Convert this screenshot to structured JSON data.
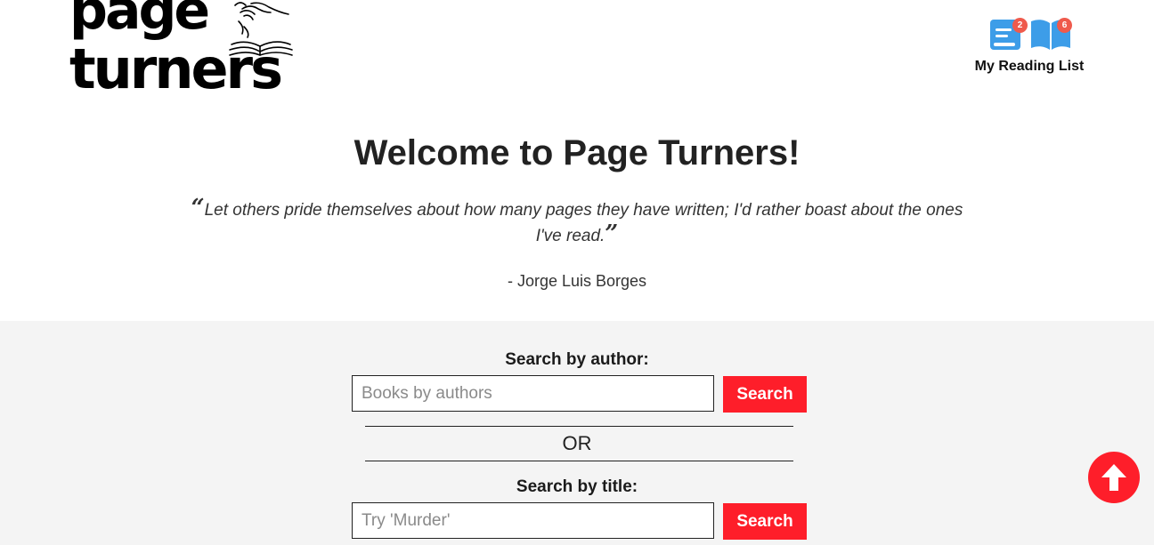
{
  "header": {
    "logo": {
      "line1": "page",
      "line2": "turners"
    },
    "reading_list": {
      "label": "My Reading List",
      "badges": [
        {
          "icon": "book-stack-icon",
          "count": "2"
        },
        {
          "icon": "open-book-icon",
          "count": "6"
        }
      ]
    }
  },
  "hero": {
    "title": "Welcome to Page Turners!",
    "quote": "Let others pride themselves about how many pages they have written; I'd rather boast about the ones I've read.",
    "open_quote": "“",
    "close_quote": "”",
    "attribution": "- Jorge Luis Borges"
  },
  "search": {
    "author": {
      "label": "Search by author:",
      "placeholder": "Books by authors",
      "value": "",
      "button": "Search"
    },
    "divider": "OR",
    "title": {
      "label": "Search by title:",
      "placeholder": "Try 'Murder'",
      "value": "",
      "button": "Search"
    }
  },
  "scroll_top": {
    "icon": "arrow-up-icon"
  },
  "colors": {
    "accent": "#fe1e2a",
    "badge": "#ef5a4c",
    "icon_blue": "#3d9de8",
    "section_bg": "#f4f4f4"
  }
}
